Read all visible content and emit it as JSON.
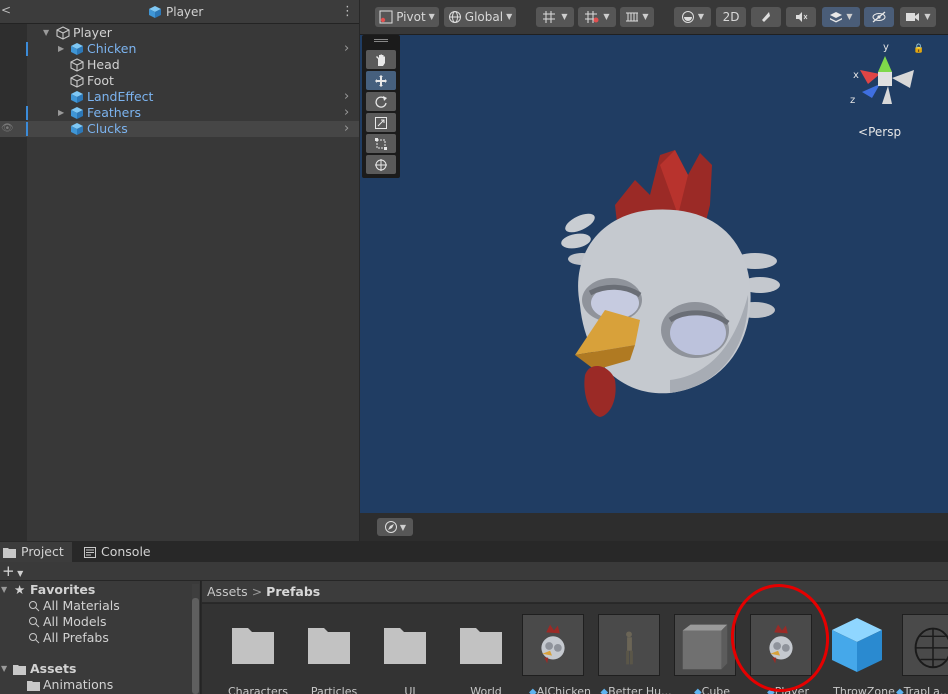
{
  "hierarchy": {
    "back": "<",
    "title": "Player",
    "menu": "⋮",
    "rows": [
      {
        "label": "Player",
        "kind": "plain",
        "indent": 1
      },
      {
        "label": "Chicken",
        "kind": "prefab",
        "indent": 2
      },
      {
        "label": "Head",
        "kind": "plain",
        "indent": 2
      },
      {
        "label": "Foot",
        "kind": "plain",
        "indent": 2
      },
      {
        "label": "LandEffect",
        "kind": "prefab",
        "indent": 2
      },
      {
        "label": "Feathers",
        "kind": "prefab",
        "indent": 2
      },
      {
        "label": "Clucks",
        "kind": "prefab",
        "indent": 2
      }
    ]
  },
  "scene": {
    "toolbar": {
      "pivot": "Pivot",
      "global": "Global",
      "mode_2d": "2D"
    },
    "tools": [
      "hand-tool",
      "move-tool",
      "rotate-tool",
      "scale-tool",
      "rect-tool",
      "transform-tool"
    ],
    "gizmo": {
      "x": "x",
      "y": "y",
      "z": "z"
    },
    "persp": "Persp"
  },
  "bottom": {
    "tabs": {
      "project": "Project",
      "console": "Console"
    },
    "plus": "+",
    "favorites": {
      "title": "Favorites",
      "items": [
        "All Materials",
        "All Models",
        "All Prefabs"
      ]
    },
    "assets_root": "Assets",
    "assets_children": [
      "Animations"
    ],
    "breadcrumb": {
      "root": "Assets",
      "sep": ">",
      "current": "Prefabs"
    },
    "grid": [
      {
        "name": "Characters",
        "type": "folder"
      },
      {
        "name": "Particles",
        "type": "folder"
      },
      {
        "name": "UI",
        "type": "folder"
      },
      {
        "name": "World",
        "type": "folder"
      },
      {
        "name": "AIChicken",
        "type": "prefab-chicken"
      },
      {
        "name": "Better Hu...",
        "type": "prefab-human"
      },
      {
        "name": "Cube",
        "type": "prefab-cube"
      },
      {
        "name": "Player",
        "type": "prefab-chicken"
      },
      {
        "name": "ThrowZone",
        "type": "prefab-bigcube"
      },
      {
        "name": "TrapLa...",
        "type": "prefab-cage"
      }
    ]
  },
  "colors": {
    "prefab_text": "#7cb4f0",
    "scene_bg": "#203d63",
    "annotation": "#e50000"
  }
}
